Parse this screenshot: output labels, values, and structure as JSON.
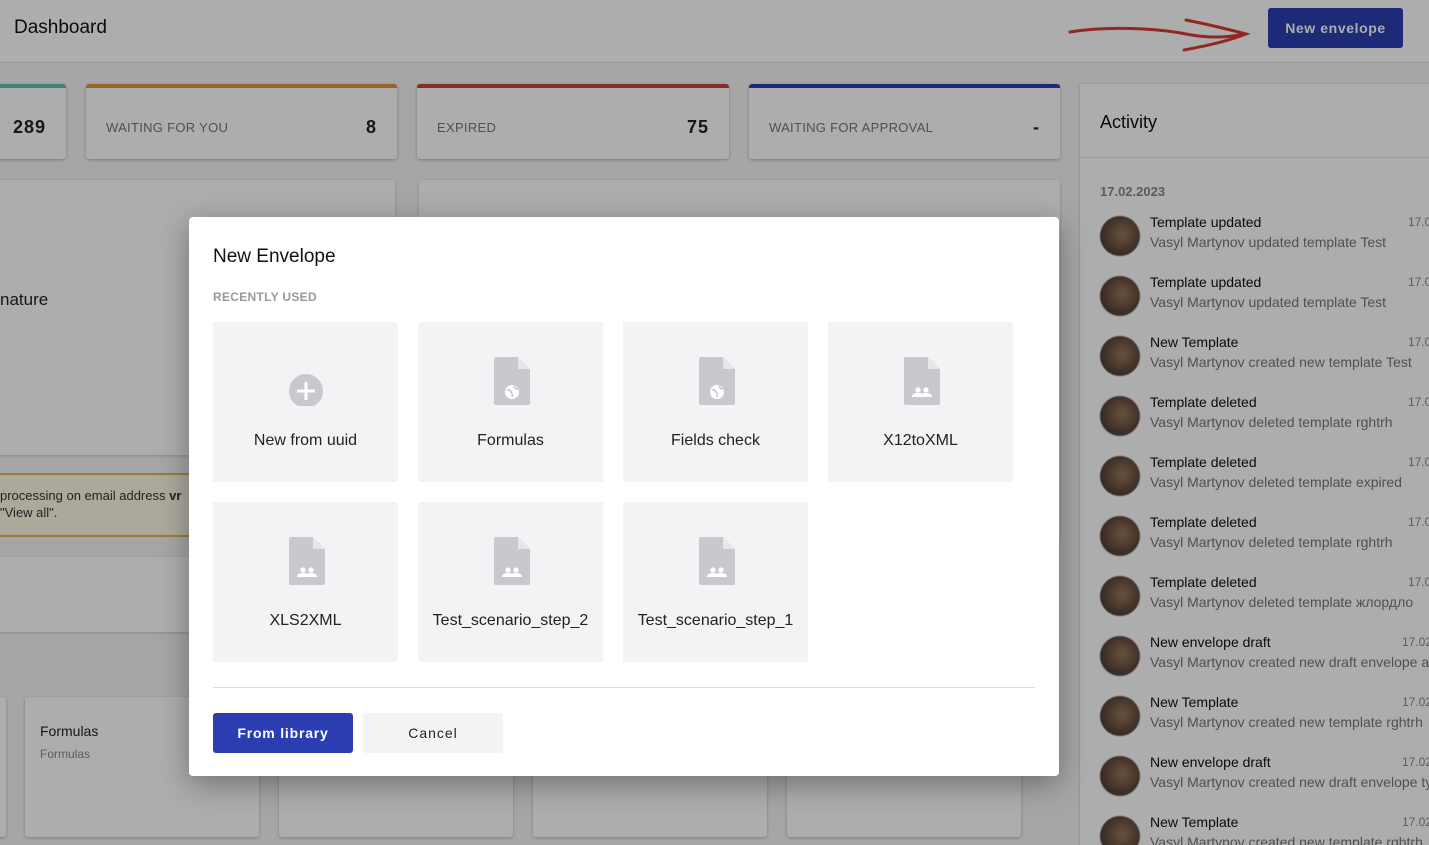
{
  "header": {
    "title": "Dashboard",
    "new_envelope_label": "New envelope",
    "annotation_color": "#d63b32"
  },
  "stats": [
    {
      "label": "",
      "value": "289",
      "color": "#5bbfb0"
    },
    {
      "label": "WAITING FOR YOU",
      "value": "8",
      "color": "#d9963a"
    },
    {
      "label": "EXPIRED",
      "value": "75",
      "color": "#c0453f"
    },
    {
      "label": "WAITING FOR APPROVAL",
      "value": "-",
      "color": "#2a3eb1"
    }
  ],
  "background": {
    "signature_text": "nature",
    "warning_line1_prefix": "processing on email address ",
    "warning_line1_suffix": "vr",
    "warning_line2": "\"View all\".",
    "tile": {
      "title": "Formulas",
      "subtitle": "Formulas"
    }
  },
  "activity": {
    "title": "Activity",
    "date": "17.02.2023",
    "items": [
      {
        "title": "Template updated",
        "desc": "Vasyl Martynov updated template Test",
        "time": "17.0"
      },
      {
        "title": "Template updated",
        "desc": "Vasyl Martynov updated template Test",
        "time": "17.0"
      },
      {
        "title": "New Template",
        "desc": "Vasyl Martynov created new template Test",
        "time": "17.0"
      },
      {
        "title": "Template deleted",
        "desc": "Vasyl Martynov deleted template rghtrh",
        "time": "17.0"
      },
      {
        "title": "Template deleted",
        "desc": "Vasyl Martynov deleted template expired",
        "time": "17.0"
      },
      {
        "title": "Template deleted",
        "desc": "Vasyl Martynov deleted template rghtrh",
        "time": "17.0"
      },
      {
        "title": "Template deleted",
        "desc": "Vasyl Martynov deleted template жлордло",
        "time": "17.0"
      },
      {
        "title": "New envelope draft",
        "desc": "Vasyl Martynov created new draft envelope a",
        "time": "17.02"
      },
      {
        "title": "New Template",
        "desc": "Vasyl Martynov created new template rghtrh",
        "time": "17.02"
      },
      {
        "title": "New envelope draft",
        "desc": "Vasyl Martynov created new draft envelope ty",
        "time": "17.02"
      },
      {
        "title": "New Template",
        "desc": "Vasyl Martynov created new template rghtrh",
        "time": "17.02"
      }
    ]
  },
  "modal": {
    "title": "New Envelope",
    "section_label": "RECENTLY USED",
    "cards": [
      {
        "label": "New from uuid",
        "icon": "plus-circle-icon"
      },
      {
        "label": "Formulas",
        "icon": "document-globe-icon"
      },
      {
        "label": "Fields check",
        "icon": "document-globe-icon"
      },
      {
        "label": "X12toXML",
        "icon": "document-people-icon"
      },
      {
        "label": "XLS2XML",
        "icon": "document-people-icon"
      },
      {
        "label": "Test_scenario_step_2",
        "icon": "document-people-icon"
      },
      {
        "label": "Test_scenario_step_1",
        "icon": "document-people-icon"
      }
    ],
    "from_library_label": "From library",
    "cancel_label": "Cancel",
    "accent": "#2a3eb1"
  }
}
